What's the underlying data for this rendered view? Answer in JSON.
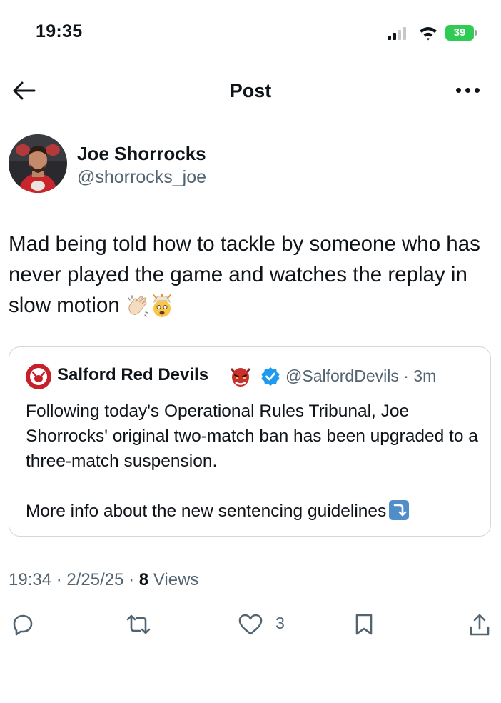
{
  "status_bar": {
    "time": "19:35",
    "battery": "39"
  },
  "nav": {
    "title": "Post"
  },
  "author": {
    "name": "Joe Shorrocks",
    "handle": "@shorrocks_joe"
  },
  "post": {
    "text": "Mad being told how to tackle by someone who has never played the game and watches the replay in slow motion"
  },
  "quote": {
    "name": "Salford Red Devils",
    "handle": "@SalfordDevils",
    "time": "3m",
    "text": "Following today's Operational Rules Tribunal, Joe Shorrocks' original two-match ban has been upgraded to a three-match suspension.",
    "more": "More info about the new sentencing guidelines"
  },
  "meta": {
    "time": "19:34",
    "date": "2/25/25",
    "views_count": "8",
    "views_label": "Views"
  },
  "actions": {
    "like_count": "3"
  },
  "icons": {
    "back": "arrow-left-icon",
    "more": "more-horizontal-icon",
    "reply": "reply-icon",
    "repost": "repost-icon",
    "like": "heart-icon",
    "bookmark": "bookmark-icon",
    "share": "share-icon",
    "verified": "verified-badge-icon"
  },
  "colors": {
    "text": "#0f1419",
    "secondary": "#536471",
    "verified": "#1d9bf0",
    "battery": "#2fcb55",
    "border": "#cfd9de"
  }
}
